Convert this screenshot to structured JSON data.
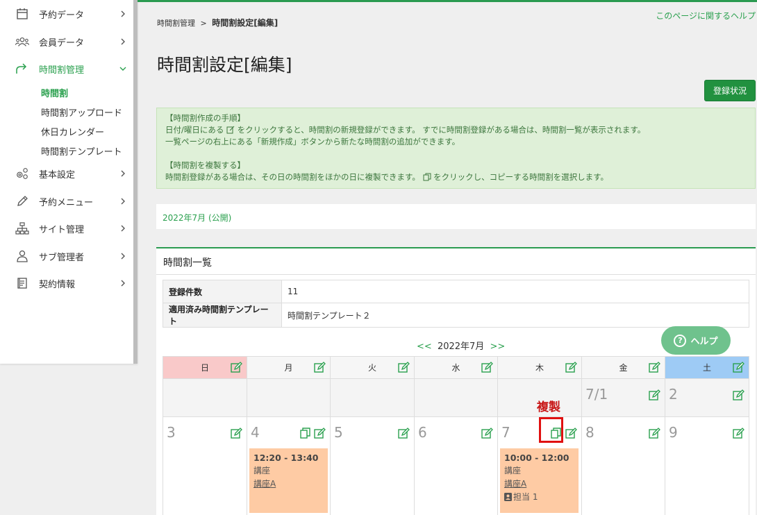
{
  "sidebar": {
    "items": [
      {
        "label": "予約データ",
        "icon": "calendar-icon"
      },
      {
        "label": "会員データ",
        "icon": "users-icon"
      },
      {
        "label": "時間割管理",
        "icon": "share-icon",
        "active": true
      },
      {
        "label": "基本設定",
        "icon": "gears-icon"
      },
      {
        "label": "予約メニュー",
        "icon": "pencil-icon"
      },
      {
        "label": "サイト管理",
        "icon": "sitemap-icon"
      },
      {
        "label": "サブ管理者",
        "icon": "user-icon"
      },
      {
        "label": "契約情報",
        "icon": "document-icon"
      }
    ],
    "sub_items": [
      "時間割",
      "時間割アップロード",
      "休日カレンダー",
      "時間割テンプレート"
    ]
  },
  "breadcrumb": {
    "parent": "時間割管理",
    "sep": ">",
    "current": "時間割設定[編集]"
  },
  "help_link": "このページに関するヘルプ",
  "page_title": "時間割設定[編集]",
  "status_button": "登録状況",
  "info": {
    "lines": [
      "【時間割作成の手順】",
      "日付/曜日にある",
      "をクリックすると、時間割の新規登録ができます。 すでに時間割登録がある場合は、時間割一覧が表示されます。",
      "一覧ページの右上にある「新規作成」ボタンから新たな時間割の追加ができます。",
      "【時間割を複製する】",
      "時間割登録がある場合は、その日の時間割をほかの日に複製できます。",
      "をクリックし、コピーする時間割を選択します。"
    ]
  },
  "month_link": "2022年7月 (公開)",
  "list": {
    "header": "時間割一覧",
    "rows": [
      {
        "key": "登録件数",
        "value": "11"
      },
      {
        "key": "適用済み時間割テンプレート",
        "value": "時間割テンプレート２"
      }
    ]
  },
  "calendar": {
    "prev": "<<",
    "month": "2022年7月",
    "next": ">>",
    "weekdays": [
      "日",
      "月",
      "火",
      "水",
      "木",
      "金",
      "土"
    ],
    "week1": [
      "",
      "",
      "",
      "",
      "",
      "7/1",
      "2"
    ],
    "week2": [
      "3",
      "4",
      "5",
      "6",
      "7",
      "8",
      "9"
    ],
    "events": [
      {
        "time": "12:20 - 13:40",
        "type": "講座",
        "name": "講座A"
      },
      {
        "time": "10:00 - 12:00",
        "type": "講座",
        "name": "講座A",
        "staff": "担当 1"
      }
    ]
  },
  "help_button": "ヘルプ",
  "callout": "複製",
  "colors": {
    "accent": "#2aa04e",
    "sunday": "#f9c9c9",
    "saturday": "#9ecbf5",
    "event": "#fecba4"
  }
}
